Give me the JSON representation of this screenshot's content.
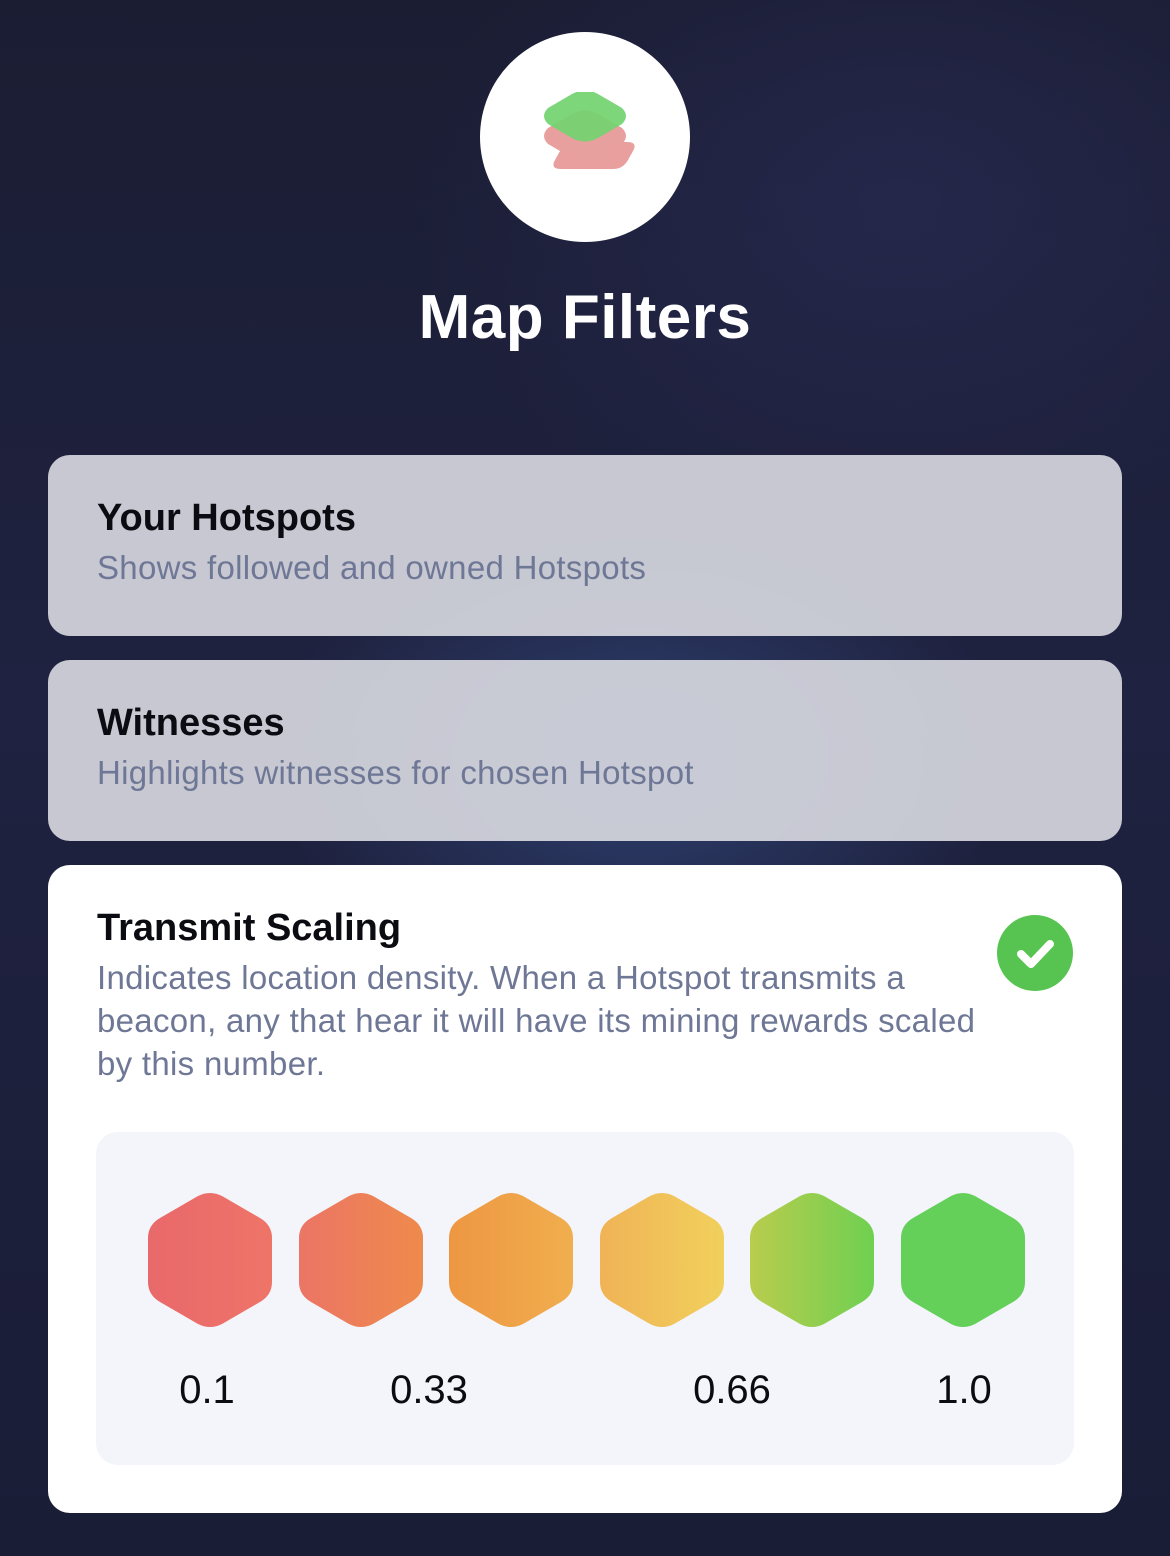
{
  "header": {
    "icon": "layers-icon",
    "title": "Map Filters"
  },
  "filters": [
    {
      "title": "Your Hotspots",
      "description": "Shows followed and owned Hotspots",
      "selected": false
    },
    {
      "title": "Witnesses",
      "description": "Highlights witnesses for chosen Hotspot",
      "selected": false
    },
    {
      "title": "Transmit Scaling",
      "description": "Indicates location density. When a Hotspot transmits a beacon, any that hear it will have its mining rewards scaled by this number.",
      "selected": true,
      "scale": {
        "labels": [
          "0.1",
          "0.33",
          "0.66",
          "1.0"
        ],
        "colors": [
          [
            "#e9696b",
            "#ee7468"
          ],
          [
            "#ec7565",
            "#ee8a4c"
          ],
          [
            "#ee9743",
            "#f0ae4e"
          ],
          [
            "#f0b356",
            "#f1d05c"
          ],
          [
            "#b9cc4e",
            "#6fd050"
          ],
          [
            "#64d05a",
            "#64d05a"
          ]
        ]
      }
    }
  ],
  "colors": {
    "check": "#57c451",
    "logo_top": "#6fd66c",
    "logo_bottom": "#e89a98"
  }
}
